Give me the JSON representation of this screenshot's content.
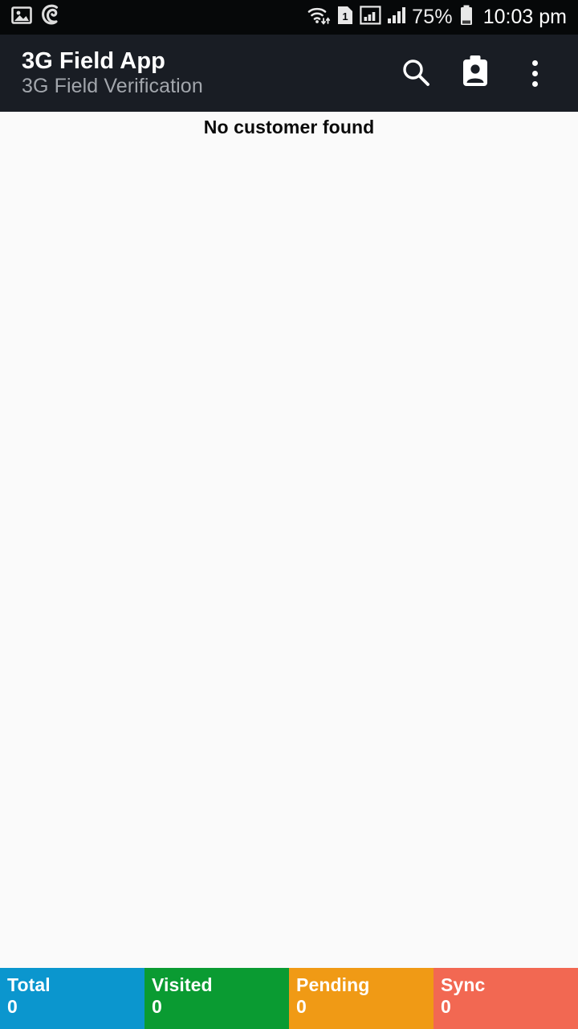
{
  "statusbar": {
    "left_icons": [
      "image-icon",
      "evernote-icon"
    ],
    "right_icons": [
      "wifi-icon",
      "sim-1-icon",
      "signal-boxed-icon",
      "signal-icon"
    ],
    "sim_label": "1",
    "battery_percent": "75%",
    "time": "10:03 pm"
  },
  "appbar": {
    "title": "3G Field App",
    "subtitle": "3G Field Verification",
    "actions": [
      {
        "name": "search-button",
        "label": "Search"
      },
      {
        "name": "customer-badge-button",
        "label": "Customers"
      },
      {
        "name": "overflow-menu-button",
        "label": "More options"
      }
    ]
  },
  "content": {
    "empty_message": "No customer found"
  },
  "summary": {
    "cards": [
      {
        "label": "Total",
        "value": "0",
        "color": "#0B96CE"
      },
      {
        "label": "Visited",
        "value": "0",
        "color": "#0A9B32"
      },
      {
        "label": "Pending",
        "value": "0",
        "color": "#F09A15"
      },
      {
        "label": "Sync",
        "value": "0",
        "color": "#F26852"
      }
    ]
  }
}
